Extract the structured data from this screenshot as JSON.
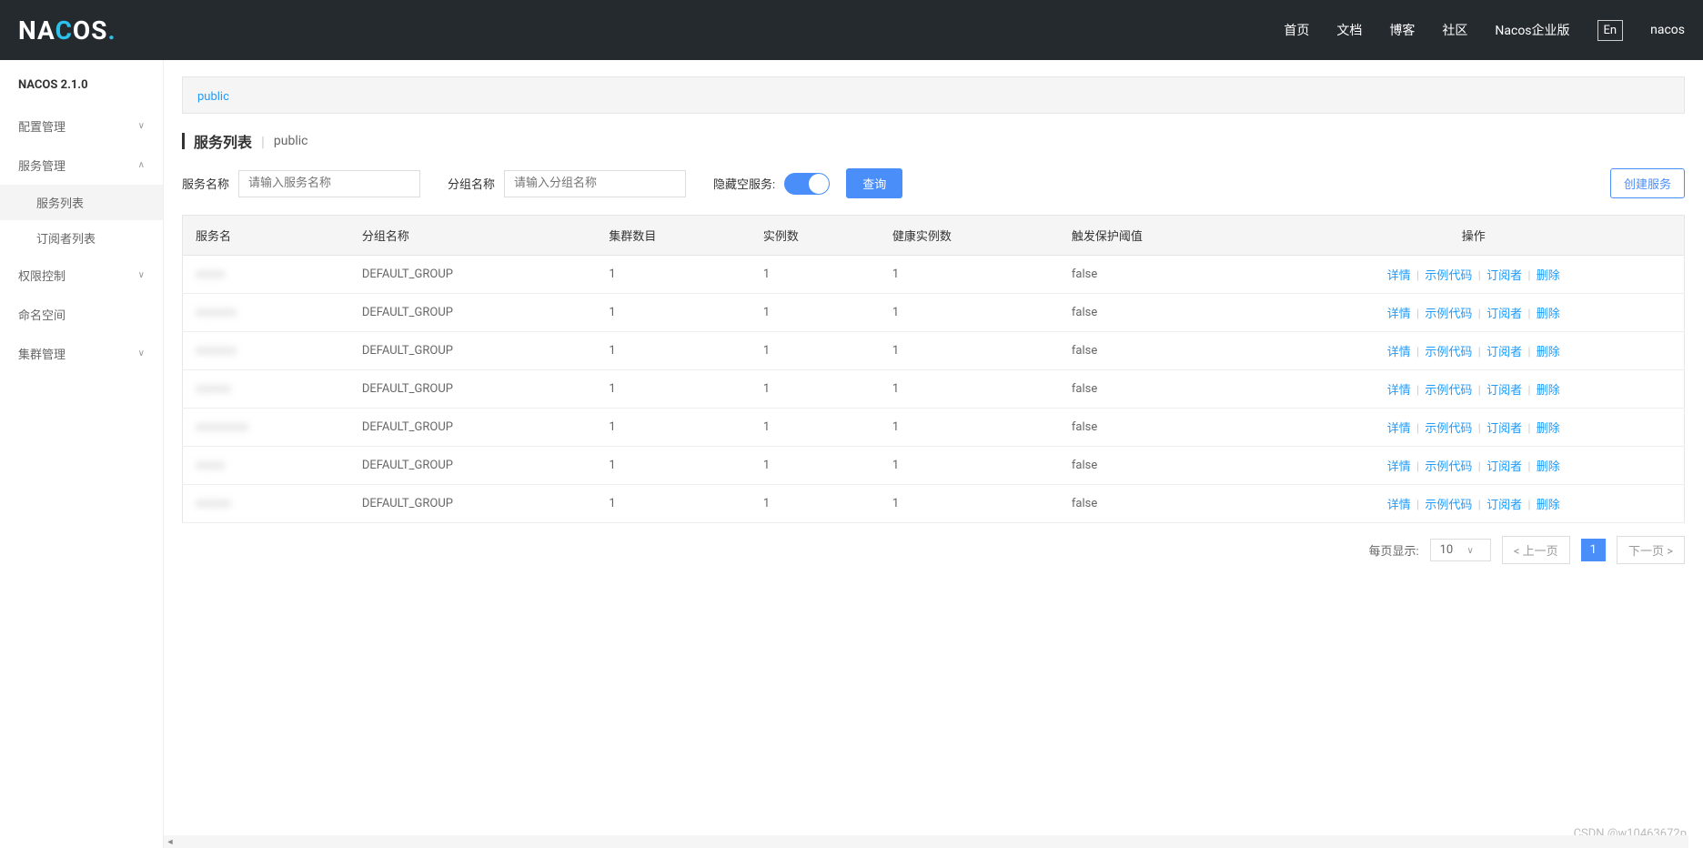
{
  "header": {
    "logo_na": "NA",
    "logo_c": "C",
    "logo_os": "OS",
    "logo_dot": ".",
    "nav": {
      "home": "首页",
      "docs": "文档",
      "blog": "博客",
      "community": "社区",
      "enterprise": "Nacos企业版"
    },
    "lang": "En",
    "user": "nacos"
  },
  "sidebar": {
    "version": "NACOS 2.1.0",
    "config_mgmt": "配置管理",
    "service_mgmt": "服务管理",
    "service_list": "服务列表",
    "subscriber_list": "订阅者列表",
    "access_control": "权限控制",
    "namespace": "命名空间",
    "cluster_mgmt": "集群管理"
  },
  "tabs": {
    "public": "public"
  },
  "page": {
    "title": "服务列表",
    "namespace": "public"
  },
  "filter": {
    "service_name_label": "服务名称",
    "service_name_placeholder": "请输入服务名称",
    "group_name_label": "分组名称",
    "group_name_placeholder": "请输入分组名称",
    "hide_empty_label": "隐藏空服务:",
    "query_btn": "查询",
    "create_btn": "创建服务"
  },
  "table": {
    "headers": {
      "service_name": "服务名",
      "group_name": "分组名称",
      "cluster_count": "集群数目",
      "instance_count": "实例数",
      "healthy_count": "健康实例数",
      "threshold": "触发保护阈值",
      "actions": "操作"
    },
    "rows": [
      {
        "service": "xxxxx",
        "group": "DEFAULT_GROUP",
        "clusters": "1",
        "instances": "1",
        "healthy": "1",
        "threshold": "false"
      },
      {
        "service": "xxxxxxx",
        "group": "DEFAULT_GROUP",
        "clusters": "1",
        "instances": "1",
        "healthy": "1",
        "threshold": "false"
      },
      {
        "service": "xxxxxxx",
        "group": "DEFAULT_GROUP",
        "clusters": "1",
        "instances": "1",
        "healthy": "1",
        "threshold": "false"
      },
      {
        "service": "xxxxxx",
        "group": "DEFAULT_GROUP",
        "clusters": "1",
        "instances": "1",
        "healthy": "1",
        "threshold": "false"
      },
      {
        "service": "xxxxxxxxx",
        "group": "DEFAULT_GROUP",
        "clusters": "1",
        "instances": "1",
        "healthy": "1",
        "threshold": "false"
      },
      {
        "service": "xxxxx",
        "group": "DEFAULT_GROUP",
        "clusters": "1",
        "instances": "1",
        "healthy": "1",
        "threshold": "false"
      },
      {
        "service": "xxxxxx",
        "group": "DEFAULT_GROUP",
        "clusters": "1",
        "instances": "1",
        "healthy": "1",
        "threshold": "false"
      }
    ],
    "actions": {
      "detail": "详情",
      "demo_code": "示例代码",
      "subscriber": "订阅者",
      "delete": "删除"
    }
  },
  "pagination": {
    "per_page_label": "每页显示:",
    "per_page_value": "10",
    "prev": "< 上一页",
    "page": "1",
    "next": "下一页 >"
  },
  "watermark": "CSDN @w10463672p"
}
